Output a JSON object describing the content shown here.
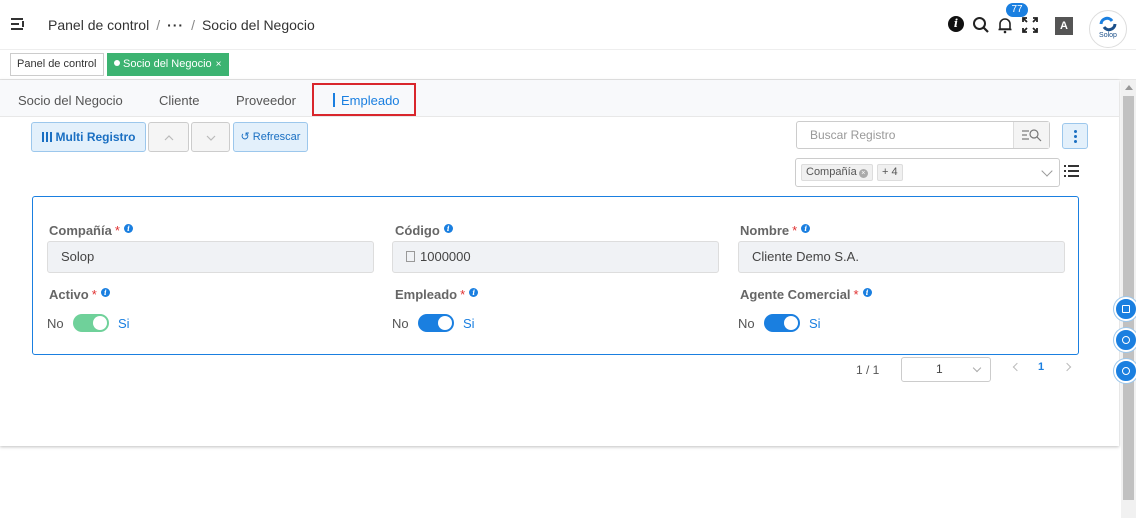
{
  "header": {
    "breadcrumb": {
      "root": "Panel de control",
      "ellipsis": "···",
      "current": "Socio del Negocio",
      "separator": "/"
    },
    "notifications_count": "77",
    "translate_label": "A",
    "avatar_text": "Solop",
    "icons": [
      "menu-collapse-icon",
      "info-icon",
      "search-icon",
      "bell-icon",
      "fullscreen-icon",
      "translate-icon"
    ]
  },
  "open_tabs": [
    {
      "label": "Panel de control",
      "active": false
    },
    {
      "label": "Socio del Negocio",
      "active": true,
      "close": "×"
    }
  ],
  "record_tabs": [
    {
      "label": "Socio del Negocio",
      "active": false
    },
    {
      "label": "Cliente",
      "active": false
    },
    {
      "label": "Proveedor",
      "active": false
    },
    {
      "label": "Empleado",
      "active": true
    }
  ],
  "toolbar": {
    "multi_label": "Multi Registro",
    "up_label": "^",
    "down_label": "v",
    "refresh_label": "↺ Refrescar",
    "search_placeholder": "Buscar Registro",
    "filter_chips": [
      {
        "label": "Compañía"
      },
      {
        "label": "+ 4"
      }
    ]
  },
  "form": {
    "compania": {
      "label": "Compañía",
      "value": "Solop",
      "required": "*"
    },
    "codigo": {
      "label": "Código",
      "value": "1000000"
    },
    "nombre": {
      "label": "Nombre",
      "value": "Cliente Demo S.A.",
      "required": "*"
    },
    "activo": {
      "label": "Activo",
      "required": "*",
      "off_label": "No",
      "on_label": "Si",
      "checked": true,
      "color": "#6fd19a"
    },
    "empleado": {
      "label": "Empleado",
      "required": "*",
      "off_label": "No",
      "on_label": "Si",
      "checked": true,
      "color": "#1a7fe0"
    },
    "agente": {
      "label": "Agente Comercial",
      "required": "*",
      "off_label": "No",
      "on_label": "Si",
      "checked": true,
      "color": "#1a7fe0"
    }
  },
  "pagination": {
    "count": "1 / 1",
    "page_size": "1",
    "current_page": "1"
  },
  "colors": {
    "accent": "#1a7fe0",
    "tab_active": "#3cb371",
    "highlight": "#d9262c",
    "required": "#e03131"
  }
}
